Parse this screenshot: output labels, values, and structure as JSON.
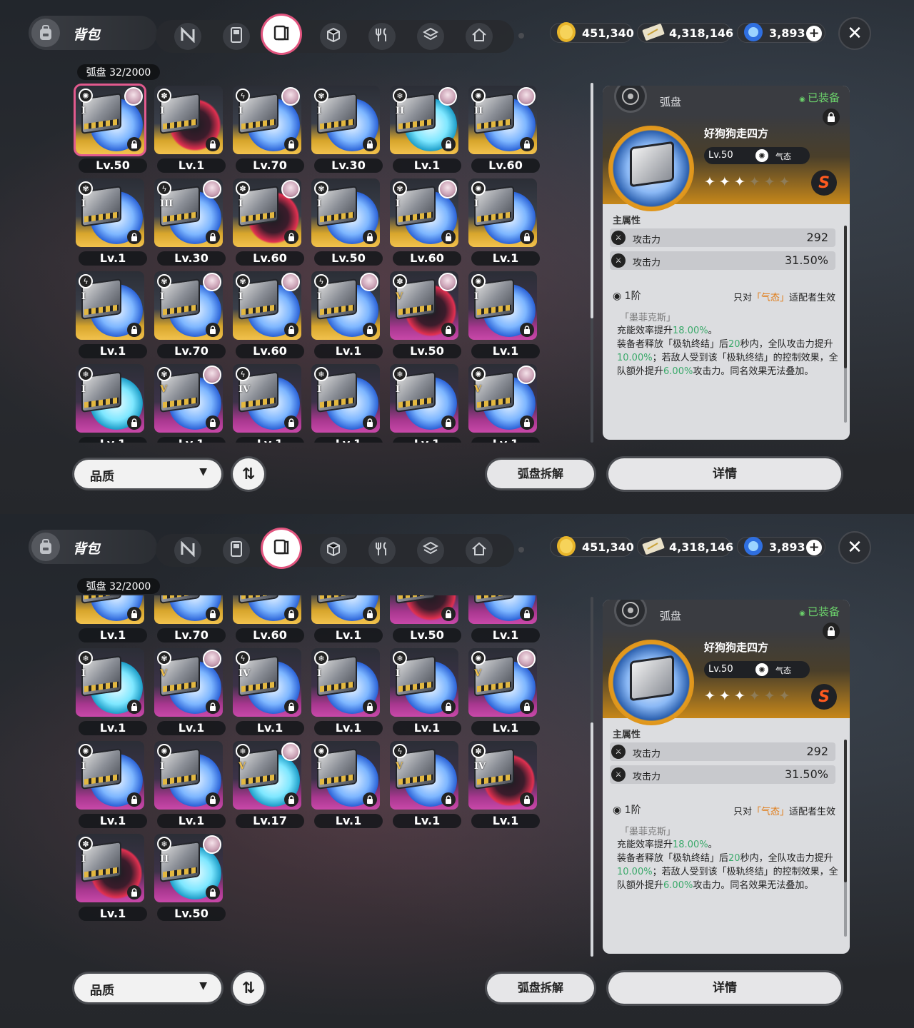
{
  "header": {
    "bag_title": "背包",
    "tabs": [
      "n-logo-icon",
      "gameboy-icon",
      "disc-book-icon",
      "cube-icon",
      "fork-knife-icon",
      "cube-outline-icon",
      "home-icon"
    ],
    "active_tab": 2,
    "currencies": [
      {
        "name": "gold-coin-icon",
        "value": "451,340"
      },
      {
        "name": "ticket-icon",
        "value": "4,318,146"
      },
      {
        "name": "polychrome-icon",
        "value": "3,893"
      }
    ],
    "close": "✕"
  },
  "inventory": {
    "count_label": "弧盘  32/2000",
    "sort_label": "品质",
    "sort_toggle": "⇅",
    "dismantle_label": "弧盘拆解",
    "details_label": "详情"
  },
  "discs": [
    {
      "level": "Lv.50",
      "tier": "I",
      "rarity": "gold",
      "disc": "blue",
      "portrait": true,
      "attr": "✺"
    },
    {
      "level": "Lv.1",
      "tier": "I",
      "rarity": "gold",
      "disc": "red",
      "portrait": false,
      "attr": "✽"
    },
    {
      "level": "Lv.70",
      "tier": "I",
      "rarity": "gold",
      "disc": "blue",
      "portrait": true,
      "attr": "ϟ"
    },
    {
      "level": "Lv.30",
      "tier": "I",
      "rarity": "gold",
      "disc": "blue",
      "portrait": false,
      "attr": "✾"
    },
    {
      "level": "Lv.1",
      "tier": "II",
      "rarity": "gold",
      "disc": "cyan",
      "portrait": true,
      "attr": "❄"
    },
    {
      "level": "Lv.60",
      "tier": "II",
      "rarity": "gold",
      "disc": "blue",
      "portrait": true,
      "attr": "✺"
    },
    {
      "level": "Lv.1",
      "tier": "I",
      "rarity": "gold",
      "disc": "blue",
      "portrait": false,
      "attr": "✾"
    },
    {
      "level": "Lv.30",
      "tier": "III",
      "rarity": "gold",
      "disc": "blue",
      "portrait": true,
      "attr": "ϟ"
    },
    {
      "level": "Lv.60",
      "tier": "I",
      "rarity": "gold",
      "disc": "red",
      "portrait": true,
      "attr": "✽"
    },
    {
      "level": "Lv.50",
      "tier": "I",
      "rarity": "gold",
      "disc": "blue",
      "portrait": false,
      "attr": "✾"
    },
    {
      "level": "Lv.60",
      "tier": "I",
      "rarity": "gold",
      "disc": "blue",
      "portrait": true,
      "attr": "✾"
    },
    {
      "level": "Lv.1",
      "tier": "I",
      "rarity": "gold",
      "disc": "blue",
      "portrait": false,
      "attr": "✺"
    },
    {
      "level": "Lv.1",
      "tier": "I",
      "rarity": "gold",
      "disc": "blue",
      "portrait": false,
      "attr": "ϟ"
    },
    {
      "level": "Lv.70",
      "tier": "I",
      "rarity": "gold",
      "disc": "blue",
      "portrait": true,
      "attr": "✾"
    },
    {
      "level": "Lv.60",
      "tier": "I",
      "rarity": "gold",
      "disc": "blue",
      "portrait": true,
      "attr": "✾"
    },
    {
      "level": "Lv.1",
      "tier": "I",
      "rarity": "gold",
      "disc": "blue",
      "portrait": true,
      "attr": "ϟ"
    },
    {
      "level": "Lv.50",
      "tier": "V",
      "rarity": "purple",
      "disc": "red",
      "portrait": true,
      "attr": "✽"
    },
    {
      "level": "Lv.1",
      "tier": "I",
      "rarity": "purple",
      "disc": "blue",
      "portrait": false,
      "attr": "✺"
    },
    {
      "level": "Lv.1",
      "tier": "I",
      "rarity": "purple",
      "disc": "cyan",
      "portrait": false,
      "attr": "❄"
    },
    {
      "level": "Lv.1",
      "tier": "V",
      "rarity": "purple",
      "disc": "blue",
      "portrait": true,
      "attr": "✾"
    },
    {
      "level": "Lv.1",
      "tier": "IV",
      "rarity": "purple",
      "disc": "blue",
      "portrait": false,
      "attr": "ϟ"
    },
    {
      "level": "Lv.1",
      "tier": "I",
      "rarity": "purple",
      "disc": "blue",
      "portrait": false,
      "attr": "❄"
    },
    {
      "level": "Lv.1",
      "tier": "I",
      "rarity": "purple",
      "disc": "blue",
      "portrait": false,
      "attr": "❄"
    },
    {
      "level": "Lv.1",
      "tier": "V",
      "rarity": "purple",
      "disc": "blue",
      "portrait": true,
      "attr": "✺"
    },
    {
      "level": "Lv.1",
      "tier": "I",
      "rarity": "purple",
      "disc": "blue",
      "portrait": false,
      "attr": "✺"
    },
    {
      "level": "Lv.1",
      "tier": "I",
      "rarity": "purple",
      "disc": "blue",
      "portrait": false,
      "attr": "✺"
    },
    {
      "level": "Lv.17",
      "tier": "V",
      "rarity": "purple",
      "disc": "cyan",
      "portrait": true,
      "attr": "❄"
    },
    {
      "level": "Lv.1",
      "tier": "I",
      "rarity": "purple",
      "disc": "blue",
      "portrait": false,
      "attr": "✺"
    },
    {
      "level": "Lv.1",
      "tier": "V",
      "rarity": "purple",
      "disc": "blue",
      "portrait": false,
      "attr": "ϟ"
    },
    {
      "level": "Lv.1",
      "tier": "IV",
      "rarity": "purple",
      "disc": "red",
      "portrait": false,
      "attr": "✽"
    },
    {
      "level": "Lv.1",
      "tier": "I",
      "rarity": "purple",
      "disc": "red",
      "portrait": false,
      "attr": "✽"
    },
    {
      "level": "Lv.50",
      "tier": "II",
      "rarity": "purple",
      "disc": "cyan",
      "portrait": true,
      "attr": "❄"
    }
  ],
  "detail": {
    "category": "弧盘",
    "equipped": "已装备",
    "name": "好狗狗走四方",
    "level": "Lv.50",
    "attribute": "气态",
    "stars_on": "✦✦✦",
    "stars_off": "✦✦✦",
    "rank": "S",
    "main_attr_label": "主属性",
    "stats": [
      {
        "name": "攻击力",
        "value": "292"
      },
      {
        "name": "攻击力",
        "value": "31.50%"
      }
    ],
    "effect_tier": "1阶",
    "effect_cond_pre": "只对",
    "effect_cond_attr": "「气态」",
    "effect_cond_post": "适配者生效",
    "effect_title": "「墨菲克斯」",
    "effect_line1_pre": "充能效率提升",
    "effect_line1_val": "18.00%",
    "effect_line1_post": "。",
    "effect_line2_pre": "装备者释放「极轨终结」后",
    "effect_line2_val1": "20",
    "effect_line2_mid": "秒内，全队攻击力提升",
    "effect_line2_val2": "10.00%",
    "effect_line2_mid2": "；若敌人受到该「极轨终结」的控制效果，全队额外提升",
    "effect_line2_val3": "6.00%",
    "effect_line2_post": "攻击力。同名效果无法叠加。"
  }
}
